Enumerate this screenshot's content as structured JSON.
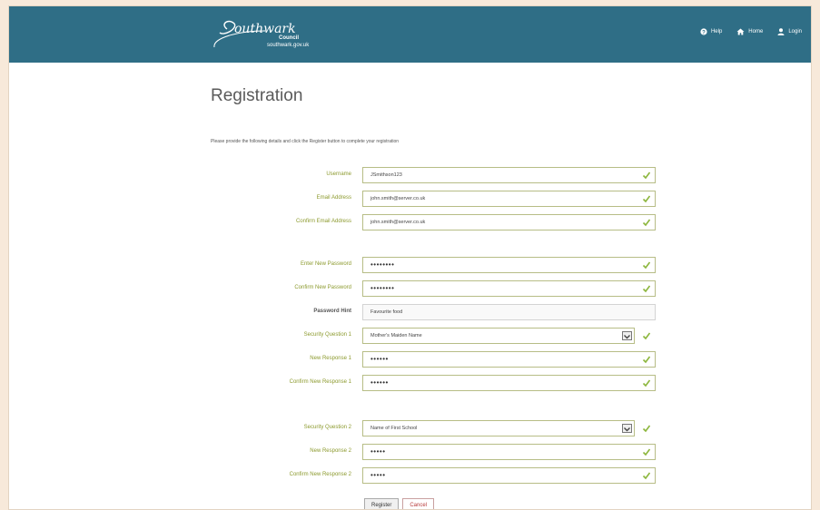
{
  "header": {
    "logo": {
      "wordmark": "Southwark",
      "council": "Council",
      "site": "southwark.gov.uk"
    },
    "nav": [
      {
        "label": "Help",
        "icon": "help-icon"
      },
      {
        "label": "Home",
        "icon": "home-icon"
      },
      {
        "label": "Login",
        "icon": "user-icon"
      }
    ],
    "colors": {
      "bar": "#2f6e86",
      "valid_label": "#8c9a2e",
      "tick": "#8cb63c"
    }
  },
  "main": {
    "title": "Registration",
    "intro": "Please provide the following details and click the Register button to complete your registration"
  },
  "form": {
    "username": {
      "label": "Username",
      "value": "JSmithson123"
    },
    "email": {
      "label": "Email Address",
      "value": "john.smith@server.co.uk"
    },
    "confirm_email": {
      "label": "Confirm Email Address",
      "value": "john.smith@server.co.uk"
    },
    "new_password": {
      "label": "Enter New Password",
      "value": "••••••••"
    },
    "confirm_password": {
      "label": "Confirm New Password",
      "value": "••••••••"
    },
    "password_hint": {
      "label": "Password Hint",
      "value": "Favourite food"
    },
    "security_q1": {
      "label": "Security Question 1",
      "value": "Mother's Maiden Name"
    },
    "response1": {
      "label": "New Response 1",
      "value": "••••••"
    },
    "confirm_response1": {
      "label": "Confirm New Response 1",
      "value": "••••••"
    },
    "security_q2": {
      "label": "Security Question 2",
      "value": "Name of First School"
    },
    "response2": {
      "label": "New Response 2",
      "value": "•••••"
    },
    "confirm_response2": {
      "label": "Confirm New Response 2",
      "value": "•••••"
    }
  },
  "buttons": {
    "register": "Register",
    "cancel": "Cancel"
  }
}
